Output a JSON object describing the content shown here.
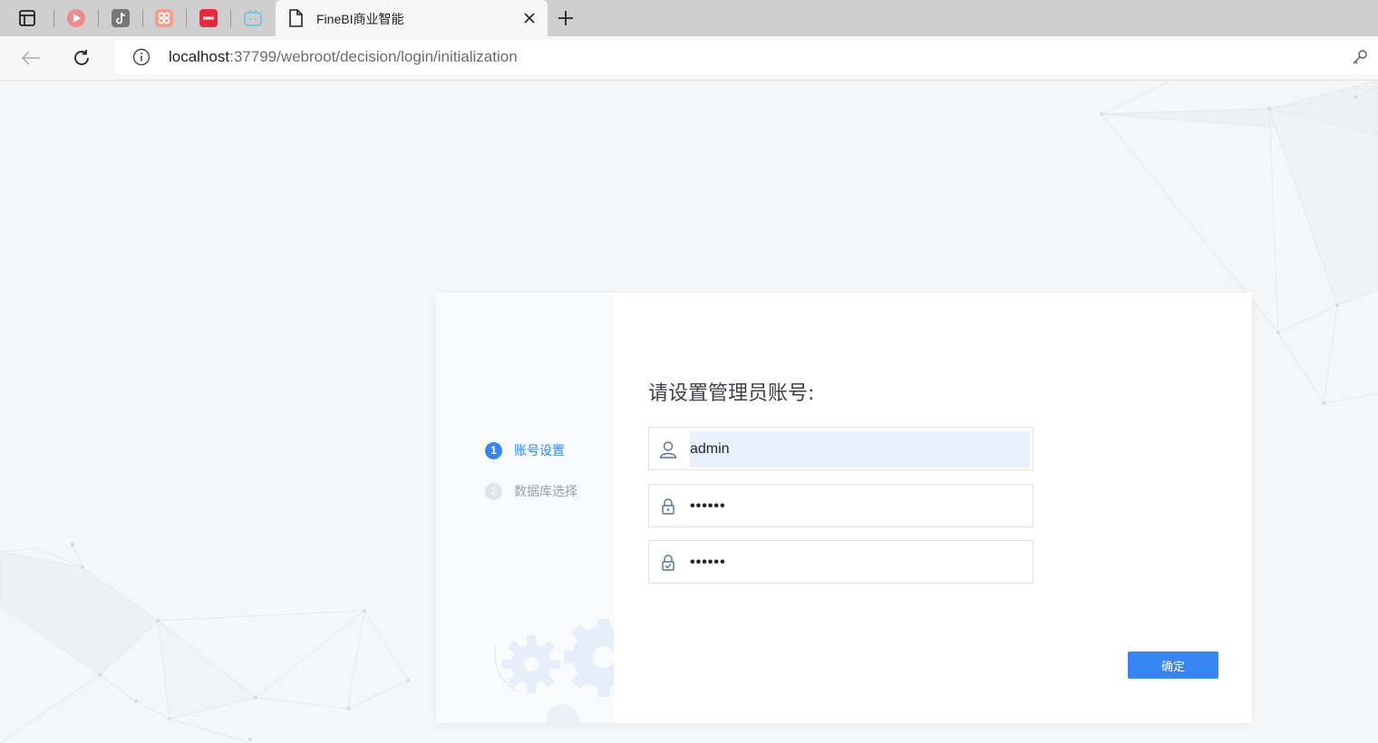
{
  "browser": {
    "tab": {
      "title": "FineBI商业智能"
    },
    "address": {
      "host": "localhost",
      "rest": ":37799/webroot/decision/login/initialization"
    }
  },
  "wizard": {
    "steps": [
      {
        "number": "1",
        "label": "账号设置",
        "state": "active"
      },
      {
        "number": "2",
        "label": "数据库选择",
        "state": "inactive"
      }
    ]
  },
  "form": {
    "title": "请设置管理员账号:",
    "username": {
      "value": "admin",
      "icon": "user-icon"
    },
    "password": {
      "value": "••••••",
      "icon": "lock-icon"
    },
    "confirm_password": {
      "value": "••••••",
      "icon": "lock-check-icon"
    },
    "submit_label": "确定"
  },
  "colors": {
    "accent": "#3685f2",
    "autofill": "#e8f0fe",
    "page_bg": "#f5f6f8"
  }
}
